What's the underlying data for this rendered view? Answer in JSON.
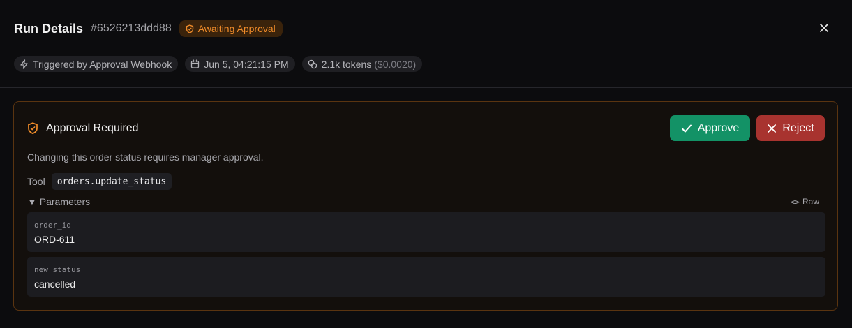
{
  "header": {
    "title": "Run Details",
    "run_id": "#6526213ddd88",
    "status": {
      "label": "Awaiting Approval",
      "icon": "shield-icon",
      "color": "#f08c2a"
    },
    "close_icon": "close-icon"
  },
  "meta": {
    "trigger": {
      "label": "Triggered by Approval Webhook",
      "icon": "lightning-icon"
    },
    "timestamp": {
      "label": "Jun 5, 04:21:15 PM",
      "icon": "calendar-icon"
    },
    "tokens": {
      "label": "2.1k tokens",
      "cost": "($0.0020)",
      "icon": "coins-icon"
    }
  },
  "approval": {
    "title": "Approval Required",
    "icon": "shield-icon",
    "description": "Changing this order status requires manager approval.",
    "approve_label": "Approve",
    "reject_label": "Reject",
    "tool_label": "Tool",
    "tool_name": "orders.update_status",
    "params_label": "▼ Parameters",
    "raw_label": "Raw",
    "parameters": [
      {
        "key": "order_id",
        "value": "ORD-611"
      },
      {
        "key": "new_status",
        "value": "cancelled"
      }
    ]
  },
  "colors": {
    "accent_orange": "#f08c2a",
    "approve_green": "#139266",
    "reject_red": "#a8332f"
  }
}
